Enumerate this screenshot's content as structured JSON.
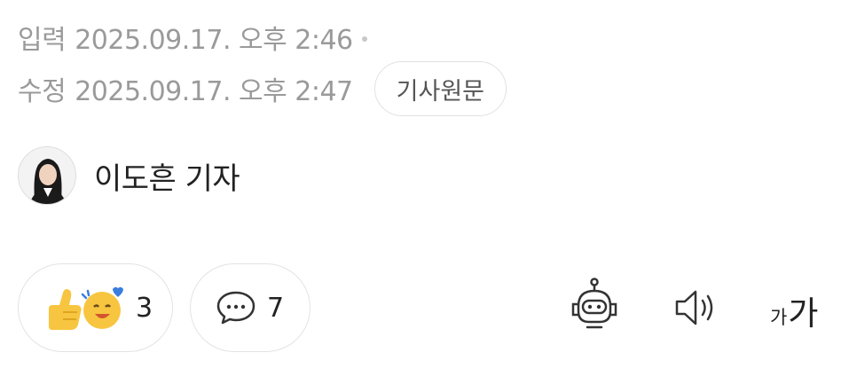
{
  "meta": {
    "input_label": "입력",
    "input_datetime": "2025.09.17. 오후 2:46",
    "edit_label": "수정",
    "edit_datetime": "2025.09.17. 오후 2:47",
    "original_button": "기사원문"
  },
  "reporter": {
    "name": "이도흔 기자"
  },
  "actions": {
    "reaction_count": "3",
    "comment_count": "7",
    "font_small": "가",
    "font_large": "가"
  },
  "icons": {
    "reaction": "thumbs-up-smile-icon",
    "comment": "speech-bubble-icon",
    "ai": "robot-icon",
    "tts": "speaker-icon"
  }
}
